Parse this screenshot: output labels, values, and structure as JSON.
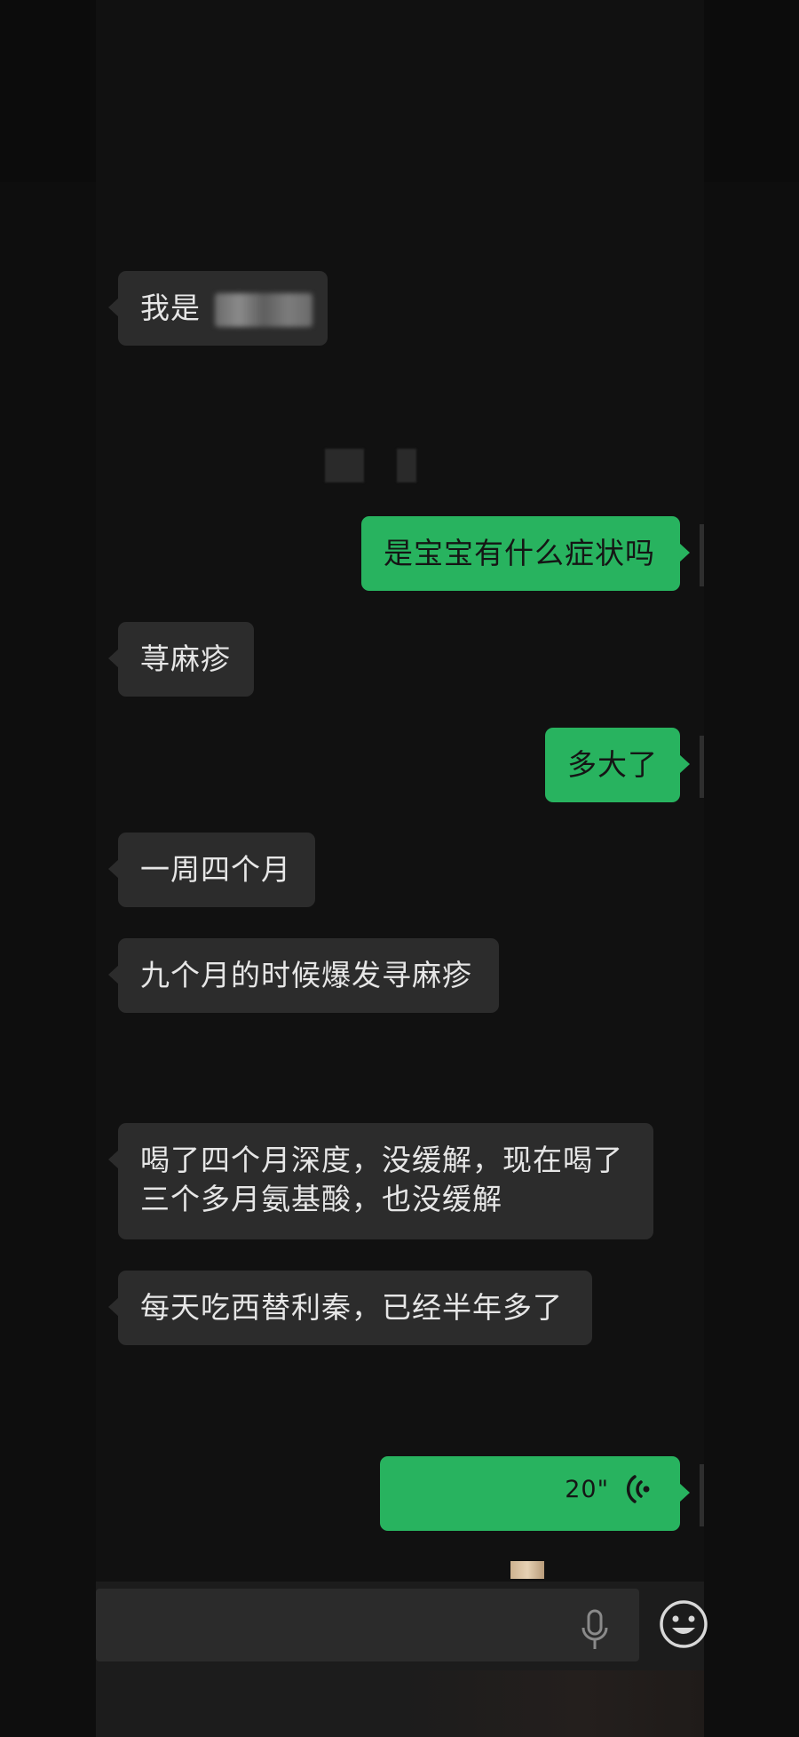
{
  "messages": [
    {
      "side": "in",
      "text": "我是"
    },
    {
      "side": "out",
      "text": "是宝宝有什么症状吗"
    },
    {
      "side": "in",
      "text": "荨麻疹"
    },
    {
      "side": "out",
      "text": "多大了"
    },
    {
      "side": "in",
      "text": "一周四个月"
    },
    {
      "side": "in",
      "text": "九个月的时候爆发寻麻疹"
    },
    {
      "side": "in",
      "line1": "喝了四个月深度，没缓解，现在喝了",
      "line2": "三个多月氨基酸，也没缓解"
    },
    {
      "side": "in",
      "text": "每天吃西替利秦，已经半年多了"
    },
    {
      "side": "out",
      "type": "voice",
      "duration": "20\""
    }
  ],
  "colors": {
    "background": "#111111",
    "incoming_bubble": "#2c2c2c",
    "outgoing_bubble": "#28b35f",
    "incoming_text": "#e6e6e6"
  },
  "icons": {
    "voice": "voice-wave-icon",
    "mic": "microphone-icon",
    "emoji": "smiley-face-icon"
  }
}
